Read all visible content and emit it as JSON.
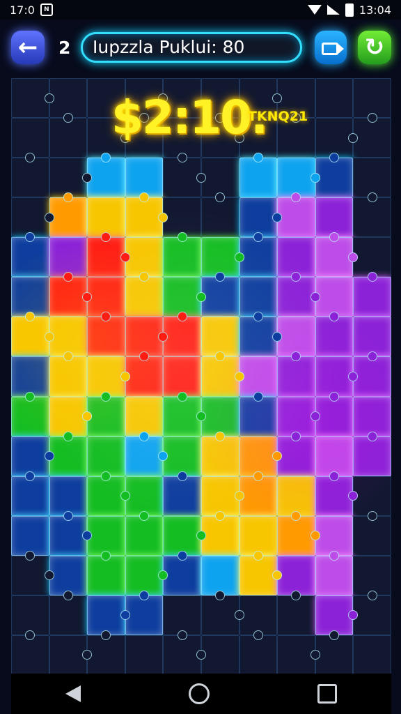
{
  "status": {
    "left_time": "17:0",
    "notification_badge": "N",
    "right_time": "13:04"
  },
  "header": {
    "level": "2",
    "title": "Iupzzla Puklui: 80"
  },
  "score": {
    "value": "$2:10.",
    "tag": "TKNQ21"
  },
  "board": {
    "colors": [
      [
        "dark",
        "dark",
        "dark",
        "dark",
        "dark",
        "dark",
        "dark",
        "dark",
        "dark",
        "dark"
      ],
      [
        "dark",
        "dark",
        "dark",
        "dark",
        "dark",
        "dark",
        "dark",
        "dark",
        "dark",
        "dark"
      ],
      [
        "dark",
        "dark",
        "cyan",
        "cyan",
        "dark",
        "dark",
        "cyan",
        "cyan",
        "blue",
        "dark"
      ],
      [
        "dark",
        "orange",
        "yellow",
        "yellow",
        "dark",
        "dark",
        "blue",
        "pink",
        "purple",
        "dark"
      ],
      [
        "blue",
        "purple",
        "red",
        "yellow",
        "green",
        "green",
        "blue",
        "purple",
        "pink",
        "dark"
      ],
      [
        "blue",
        "red",
        "red",
        "yellow",
        "green",
        "blue",
        "blue",
        "purple",
        "pink",
        "purple"
      ],
      [
        "yellow",
        "yellow",
        "red",
        "red",
        "red",
        "yellow",
        "blue",
        "pink",
        "purple",
        "purple"
      ],
      [
        "blue",
        "yellow",
        "yellow",
        "red",
        "red",
        "yellow",
        "pink",
        "purple",
        "purple",
        "purple"
      ],
      [
        "green",
        "yellow",
        "green",
        "yellow",
        "green",
        "green",
        "blue",
        "purple",
        "purple",
        "purple"
      ],
      [
        "blue",
        "green",
        "green",
        "cyan",
        "green",
        "yellow",
        "orange",
        "purple",
        "pink",
        "purple"
      ],
      [
        "blue",
        "blue",
        "green",
        "green",
        "blue",
        "yellow",
        "orange",
        "yellow",
        "purple",
        "dark"
      ],
      [
        "blue",
        "blue",
        "green",
        "green",
        "green",
        "yellow",
        "yellow",
        "orange",
        "pink",
        "dark"
      ],
      [
        "dark",
        "blue",
        "green",
        "green",
        "blue",
        "cyan",
        "yellow",
        "purple",
        "pink",
        "dark"
      ],
      [
        "dark",
        "dark",
        "blue",
        "blue",
        "dark",
        "dark",
        "dark",
        "dark",
        "purple",
        "dark"
      ],
      [
        "dark",
        "dark",
        "dark",
        "dark",
        "dark",
        "dark",
        "dark",
        "dark",
        "dark",
        "dark"
      ]
    ]
  },
  "nav": {
    "icons": [
      "back-triangle",
      "home-circle",
      "recents-square"
    ]
  }
}
